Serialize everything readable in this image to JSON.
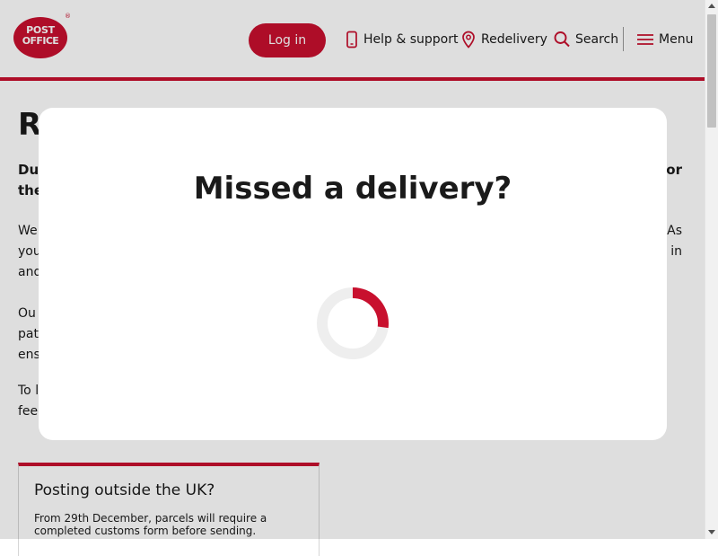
{
  "header": {
    "logo_line1": "POST",
    "logo_line2": "OFFICE",
    "logo_reg": "®",
    "login_label": "Log in",
    "help_label": "Help & support",
    "redelivery_label": "Redelivery",
    "search_label": "Search",
    "menu_label": "Menu"
  },
  "page": {
    "heading_partial": "R",
    "lead_left": "Du",
    "lead_right": "for",
    "lead_left2": "the",
    "p1_line1_left": "We",
    "p1_line1_right": "As",
    "p1_line2_left": "you",
    "p1_line2_right": "e in",
    "p1_line3_left": "and",
    "p2_line1_left": "Ou",
    "p2_line2_left": "pati",
    "p2_line3_left": "ens",
    "p3_line1_left": "To l",
    "p3_line2_left": "feed"
  },
  "card": {
    "title": "Posting outside the UK?",
    "text": "From 29th December, parcels will require a completed customs form before sending."
  },
  "modal": {
    "title": "Missed a delivery?",
    "loading_progress": 0.27
  },
  "colors": {
    "brand": "#c8102e",
    "text": "#1a1a1a",
    "spinner_track": "#eeeeee"
  },
  "icons": [
    "phone-icon",
    "location-pin-icon",
    "search-icon",
    "menu-icon",
    "spinner-icon"
  ]
}
